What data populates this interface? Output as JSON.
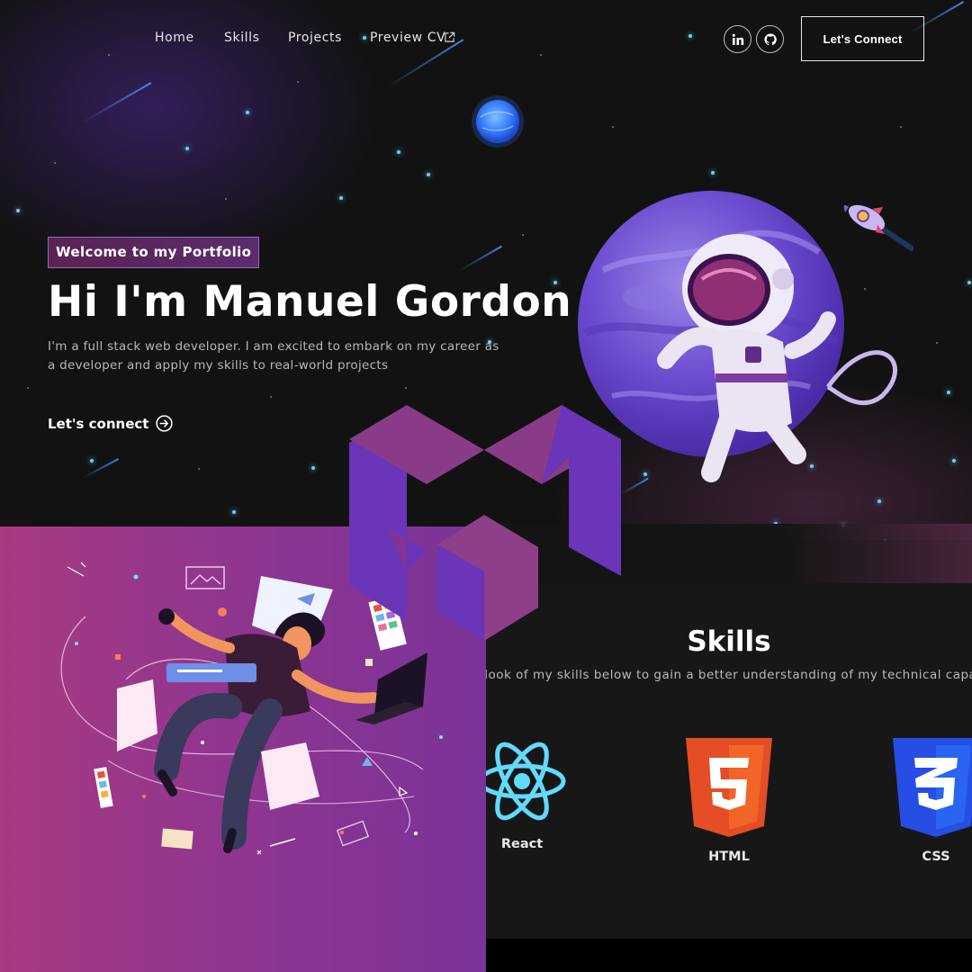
{
  "nav": {
    "links": [
      "Home",
      "Skills",
      "Projects",
      "Preview CV"
    ],
    "social": [
      "linkedin-icon",
      "github-icon"
    ],
    "cta_label": "Let's Connect"
  },
  "hero": {
    "badge": "Welcome to my Portfolio",
    "title": "Hi I'm Manuel Gordon",
    "description": "I'm a full stack web developer. I am excited to embark on my career as a developer and apply my skills to real-world projects",
    "cta_label": "Let's connect"
  },
  "skills": {
    "title": "Skills",
    "subtitle": "Take a look of my skills below to gain a better understanding of my technical capabilities.",
    "items": [
      {
        "label": "React",
        "icon": "react-icon"
      },
      {
        "label": "HTML",
        "icon": "html5-icon"
      },
      {
        "label": "CSS",
        "icon": "css3-icon"
      }
    ]
  },
  "colors": {
    "background": "#121212",
    "accent_purple": "#6a35b8",
    "accent_magenta": "#a73a82",
    "logo_light": "#8d3e8c",
    "react_cyan": "#61dafb",
    "html_orange": "#e44d26",
    "css_blue": "#264de4"
  }
}
